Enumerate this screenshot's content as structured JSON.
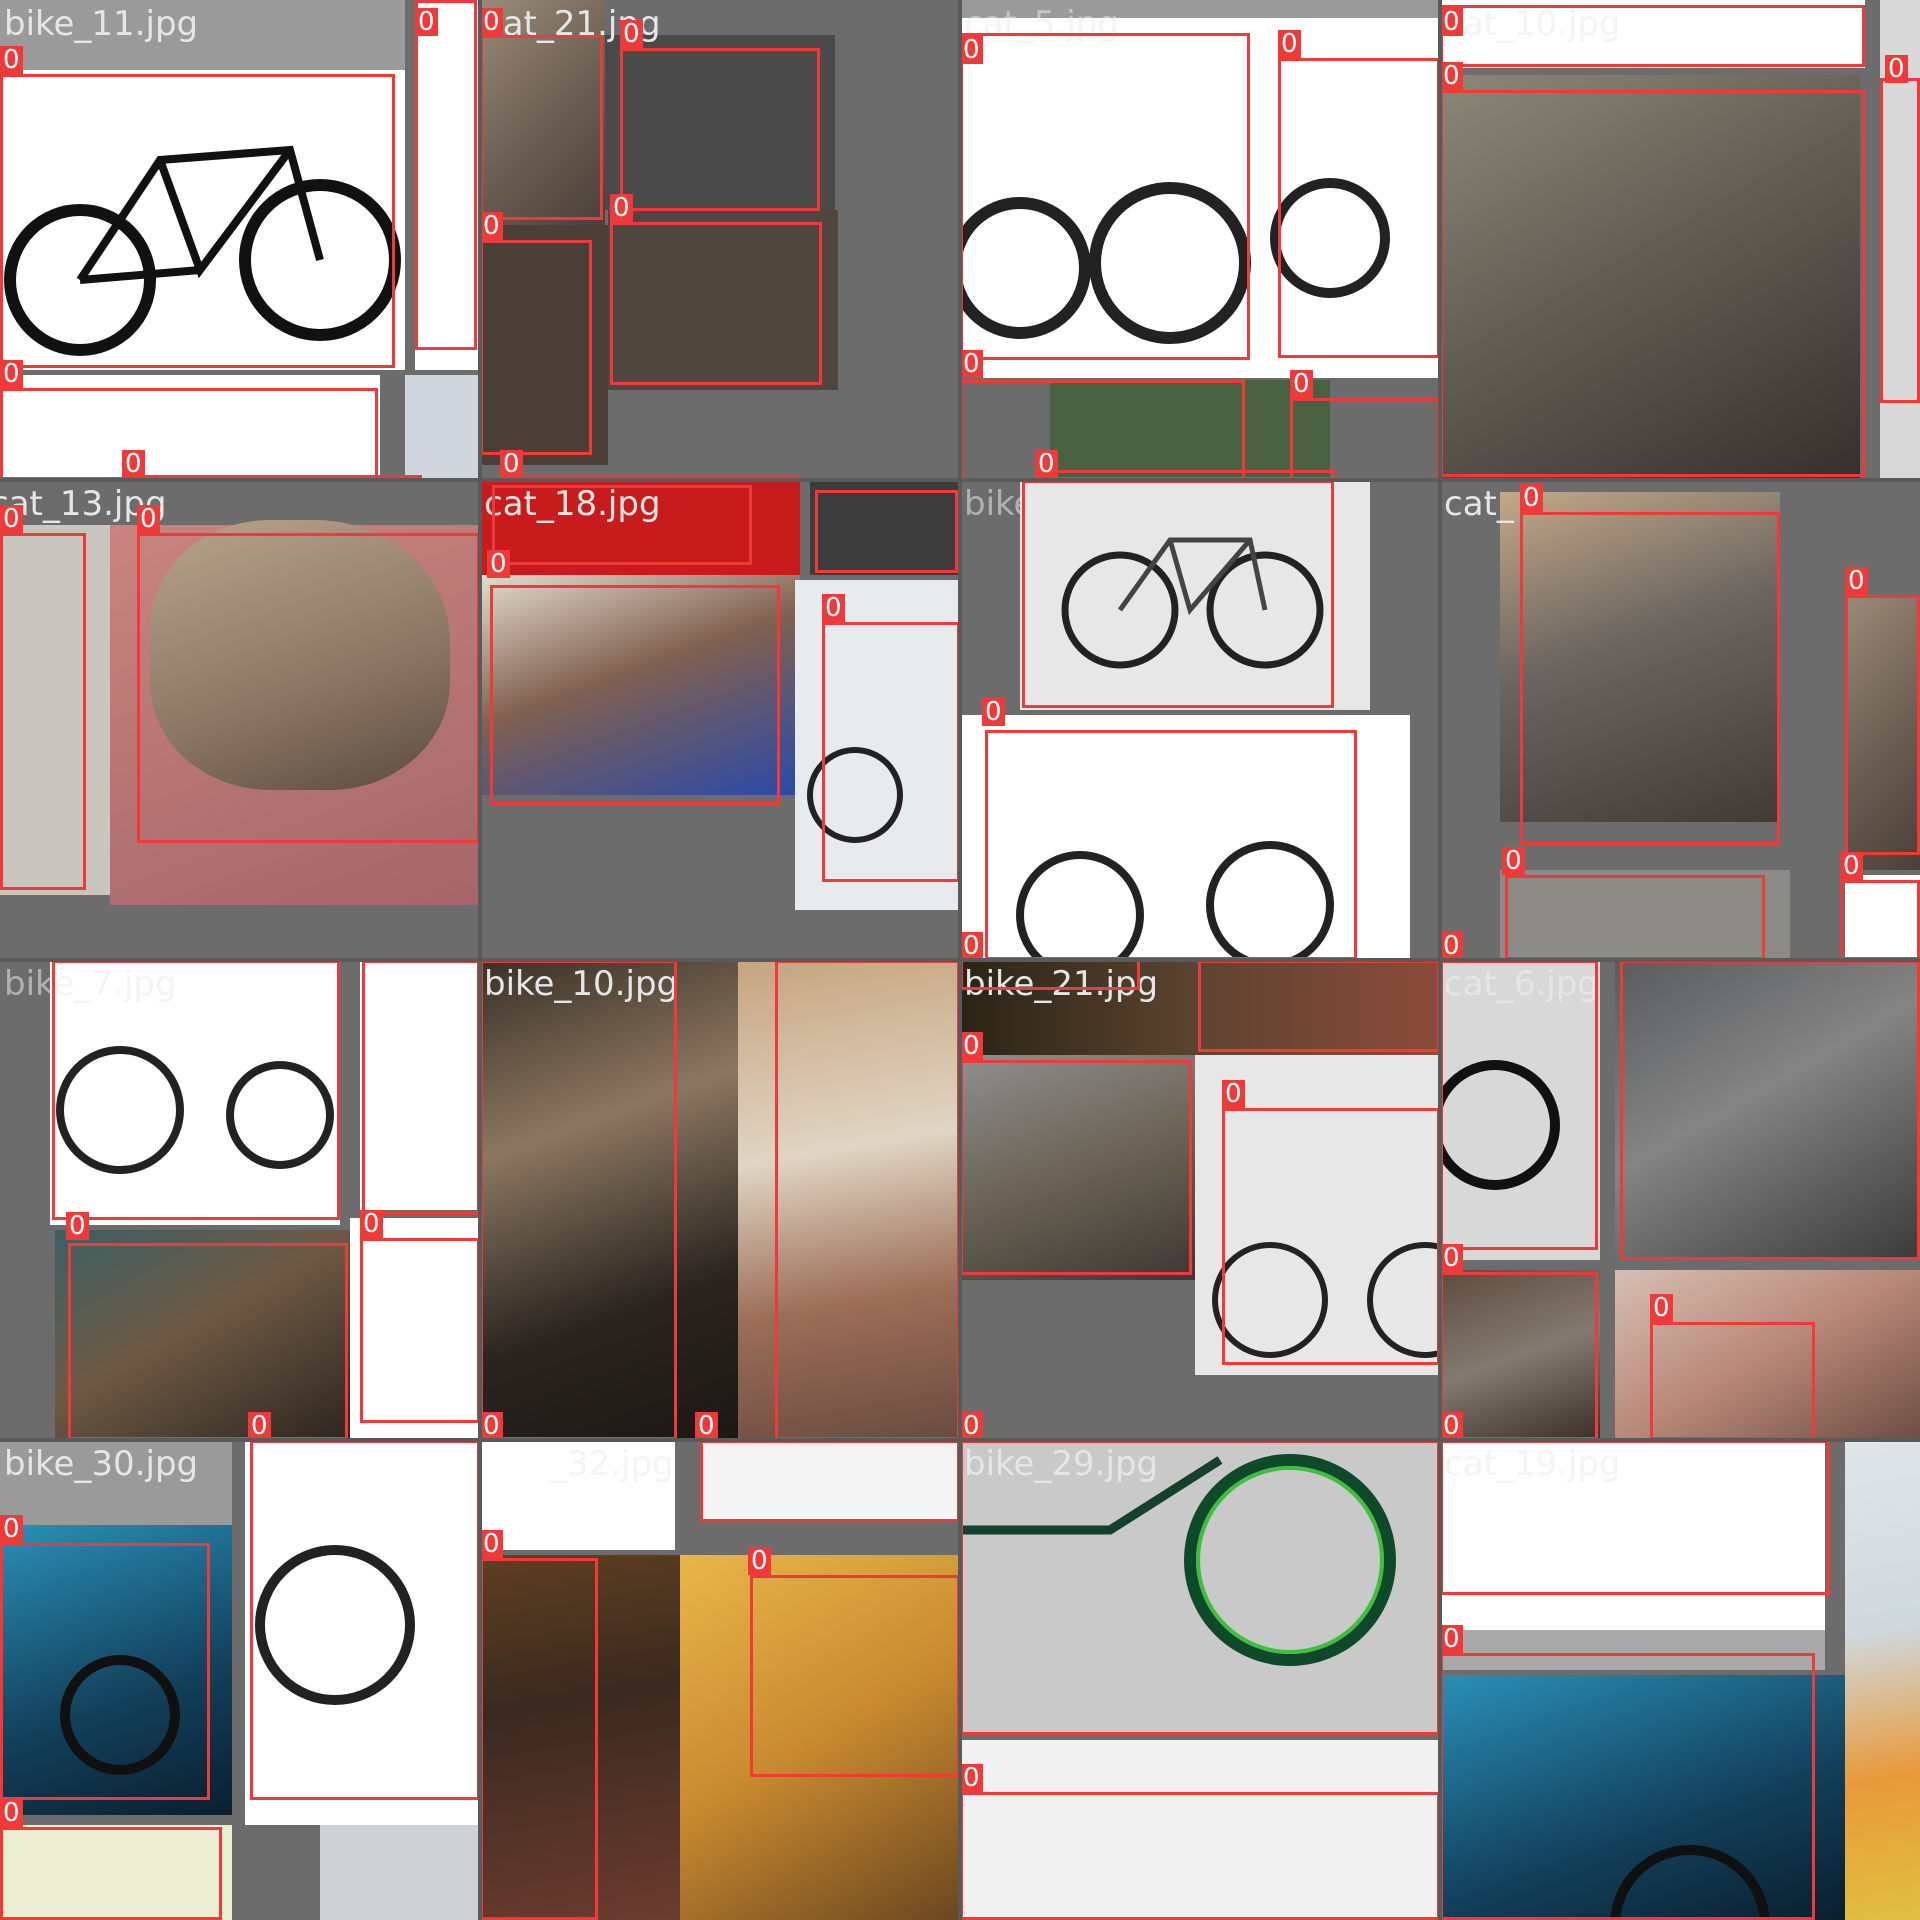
{
  "box_color": "#f03a3a",
  "tiles": [
    {
      "filename": "bike_11.jpg",
      "labels": [
        "0",
        "0",
        "0",
        "0"
      ]
    },
    {
      "filename": "cat_21.jpg",
      "labels": [
        "0",
        "0",
        "0",
        "0",
        "0"
      ]
    },
    {
      "filename": "cat_5.jpg",
      "labels": [
        "0",
        "0",
        "0",
        "0",
        "0"
      ]
    },
    {
      "filename": "cat_10.jpg",
      "labels": [
        "0",
        "0",
        "0"
      ]
    },
    {
      "filename": "cat_13.jpg",
      "labels": [
        "0",
        "0"
      ]
    },
    {
      "filename": "cat_18.jpg",
      "labels": [
        "0",
        "0",
        "0",
        "0"
      ]
    },
    {
      "filename": "bike",
      "labels": [
        "0",
        "0",
        "0"
      ]
    },
    {
      "filename": "cat_",
      "labels": [
        "0",
        "0",
        "0",
        "0",
        "0"
      ]
    },
    {
      "filename": "bike_7.jpg",
      "labels": [
        "0",
        "0",
        "0",
        "0",
        "0"
      ]
    },
    {
      "filename": "bike_10.jpg",
      "labels": [
        "0",
        "0",
        "0",
        "0"
      ]
    },
    {
      "filename": "bike_21.jpg",
      "labels": [
        "0",
        "0",
        "0",
        "0"
      ]
    },
    {
      "filename": "cat_6.jpg",
      "labels": [
        "0",
        "0",
        "0",
        "0",
        "0"
      ]
    },
    {
      "filename": "bike_30.jpg",
      "labels": [
        "0",
        "0",
        "0"
      ]
    },
    {
      "filename": "_32.jpg",
      "labels": [
        "0",
        "0"
      ]
    },
    {
      "filename": "bike_29.jpg",
      "labels": [
        "0"
      ]
    },
    {
      "filename": "cat_19.jpg",
      "labels": [
        "0"
      ]
    }
  ]
}
